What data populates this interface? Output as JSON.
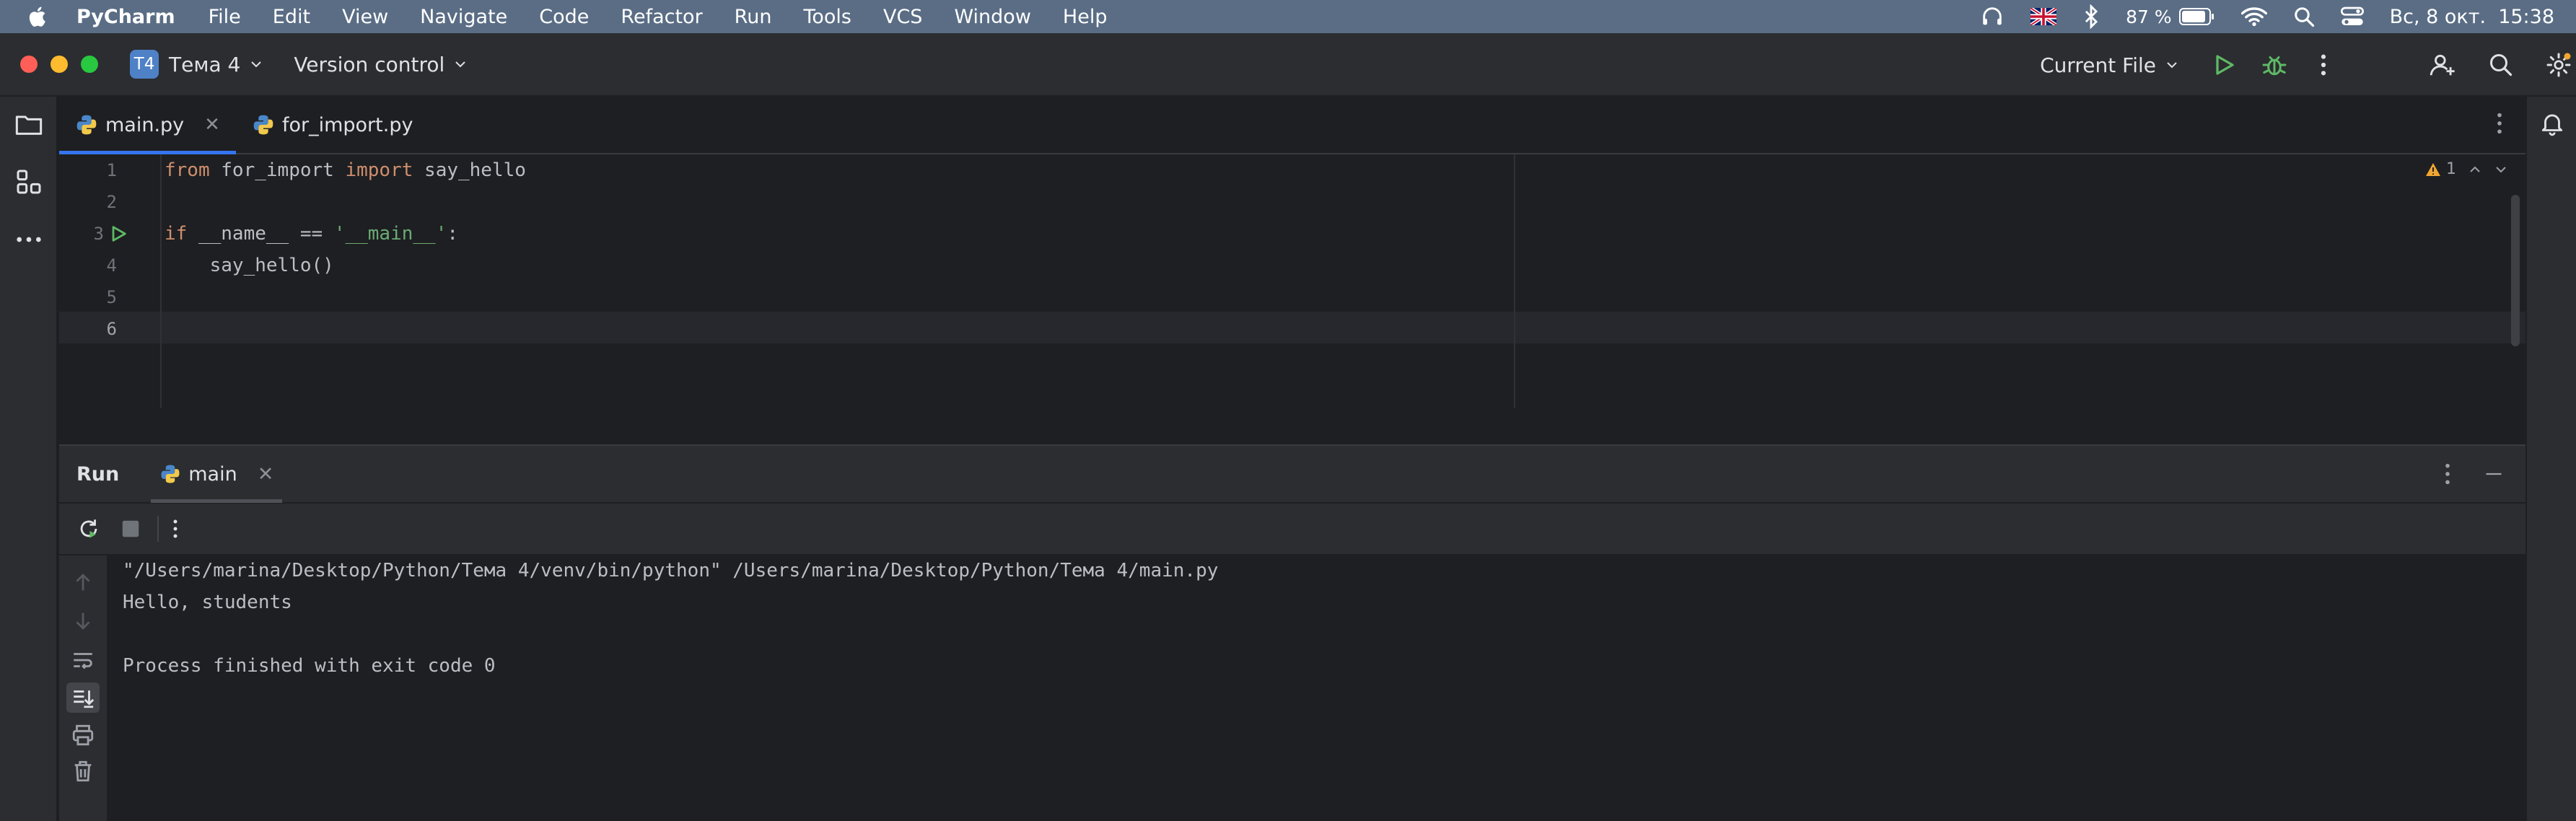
{
  "menubar": {
    "app_name": "PyCharm",
    "items": [
      "File",
      "Edit",
      "View",
      "Navigate",
      "Code",
      "Refactor",
      "Run",
      "Tools",
      "VCS",
      "Window",
      "Help"
    ],
    "battery": "87 %",
    "datetime": "Вс, 8 окт.  15:38"
  },
  "toolbar": {
    "project_badge": "T4",
    "project_name": "Тема 4",
    "vcs_label": "Version control",
    "run_config": "Current File"
  },
  "tabs": [
    {
      "label": "main.py",
      "active": true
    },
    {
      "label": "for_import.py",
      "active": false
    }
  ],
  "editor": {
    "line_numbers": [
      "1",
      "2",
      "3",
      "4",
      "5",
      "6"
    ],
    "lines": {
      "l1": {
        "kw1": "from",
        "mod": " for_import ",
        "kw2": "import",
        "name": " say_hello"
      },
      "l3": {
        "kw": "if",
        "mid": " __name__ == ",
        "str": "'__main__'",
        "end": ":"
      },
      "l4": "    say_hello()"
    },
    "warnings_count": "1"
  },
  "run_panel": {
    "title": "Run",
    "tab_label": "main",
    "output": [
      "\"/Users/marina/Desktop/Python/Тема 4/venv/bin/python\" /Users/marina/Desktop/Python/Тема 4/main.py",
      "Hello, students",
      "",
      "Process finished with exit code 0"
    ]
  },
  "colors": {
    "accent": "#3574f0",
    "run_green": "#5fb865",
    "menubar_bg": "#5a6d85",
    "keyword": "#cf8e6d",
    "string": "#6aab73"
  }
}
